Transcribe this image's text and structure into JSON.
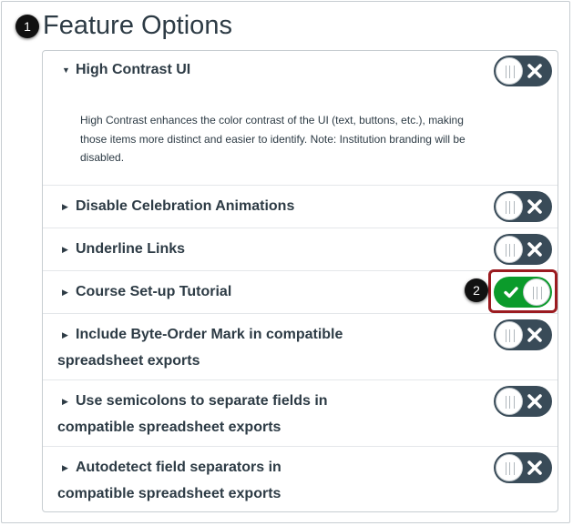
{
  "callouts": {
    "first": "1",
    "second": "2"
  },
  "header": {
    "title": "Feature Options"
  },
  "features": [
    {
      "line1": "High Contrast UI",
      "line2": "",
      "expanded": true,
      "enabled": false,
      "description": "High Contrast enhances the color contrast of the UI (text, buttons, etc.), making those items more distinct and easier to identify. Note: Institution branding will be disabled."
    },
    {
      "line1": "Disable Celebration Animations",
      "line2": "",
      "expanded": false,
      "enabled": false
    },
    {
      "line1": "Underline Links",
      "line2": "",
      "expanded": false,
      "enabled": false
    },
    {
      "line1": "Course Set-up Tutorial",
      "line2": "",
      "expanded": false,
      "enabled": true
    },
    {
      "line1": "Include Byte-Order Mark in compatible",
      "line2": "spreadsheet exports",
      "expanded": false,
      "enabled": false
    },
    {
      "line1": "Use semicolons to separate fields in",
      "line2": "compatible spreadsheet exports",
      "expanded": false,
      "enabled": false
    },
    {
      "line1": "Autodetect field separators in",
      "line2": "compatible spreadsheet exports",
      "expanded": false,
      "enabled": false
    }
  ],
  "icons": {
    "expanded_caret": "caret-down-icon",
    "collapsed_caret": "caret-right-icon",
    "off": "x-icon",
    "on": "check-icon"
  },
  "colors": {
    "toggle_off": "#394b58",
    "toggle_on": "#0b9b2b",
    "highlight": "#9b1b20",
    "text": "#2d3b45"
  }
}
